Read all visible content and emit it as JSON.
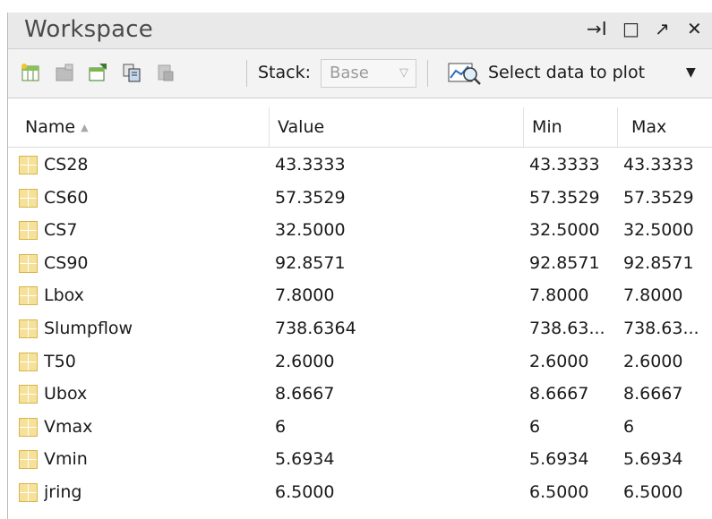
{
  "title": "Workspace",
  "window_controls": {
    "pin": "→I",
    "maximize": "□",
    "undock": "↗",
    "close": "✕"
  },
  "toolbar": {
    "stack_label": "Stack:",
    "stack_value": "Base",
    "plot_label": "Select data to plot"
  },
  "columns": {
    "name": "Name",
    "value": "Value",
    "min": "Min",
    "max": "Max"
  },
  "rows": [
    {
      "name": "CS28",
      "value": "43.3333",
      "min": "43.3333",
      "max": "43.3333"
    },
    {
      "name": "CS60",
      "value": "57.3529",
      "min": "57.3529",
      "max": "57.3529"
    },
    {
      "name": "CS7",
      "value": "32.5000",
      "min": "32.5000",
      "max": "32.5000"
    },
    {
      "name": "CS90",
      "value": "92.8571",
      "min": "92.8571",
      "max": "92.8571"
    },
    {
      "name": "Lbox",
      "value": "7.8000",
      "min": "7.8000",
      "max": "7.8000"
    },
    {
      "name": "Slumpflow",
      "value": "738.6364",
      "min": "738.63...",
      "max": "738.63..."
    },
    {
      "name": "T50",
      "value": "2.6000",
      "min": "2.6000",
      "max": "2.6000"
    },
    {
      "name": "Ubox",
      "value": "8.6667",
      "min": "8.6667",
      "max": "8.6667"
    },
    {
      "name": "Vmax",
      "value": "6",
      "min": "6",
      "max": "6"
    },
    {
      "name": "Vmin",
      "value": "5.6934",
      "min": "5.6934",
      "max": "5.6934"
    },
    {
      "name": "jring",
      "value": "6.5000",
      "min": "6.5000",
      "max": "6.5000"
    }
  ],
  "icons": [
    "new-variable-icon",
    "import-data-icon",
    "save-workspace-icon",
    "copy-icon",
    "delete-icon",
    "plot-selector-icon",
    "variable-icon"
  ],
  "colors": {
    "title_bar": "#e9e9e9",
    "toolbar": "#f3f3f3",
    "variable_icon": "#f6e19a"
  }
}
